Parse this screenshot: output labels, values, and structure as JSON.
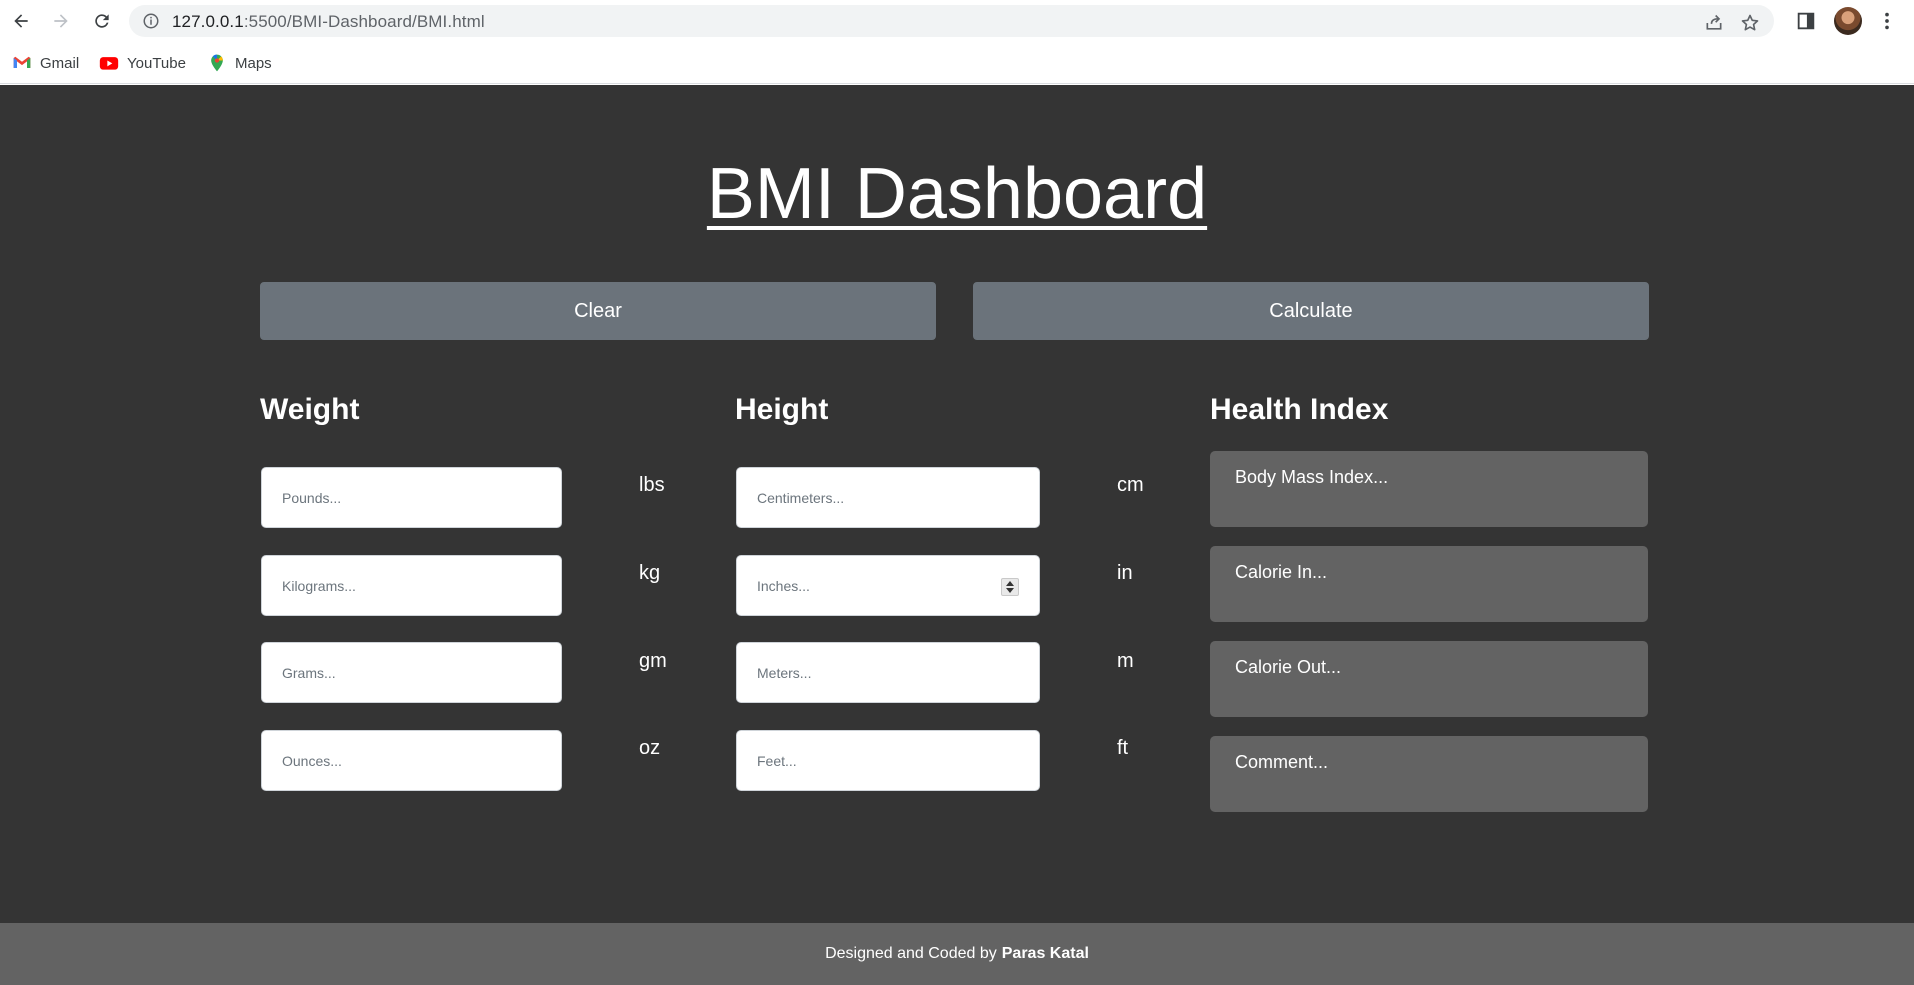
{
  "browser": {
    "url_host": "127.0.0.1",
    "url_path": ":5500/BMI-Dashboard/BMI.html",
    "bookmarks": [
      {
        "label": "Gmail",
        "icon": "gmail-icon"
      },
      {
        "label": "YouTube",
        "icon": "youtube-icon"
      },
      {
        "label": "Maps",
        "icon": "maps-icon"
      }
    ]
  },
  "page": {
    "title": "BMI Dashboard",
    "clear_label": "Clear",
    "calculate_label": "Calculate"
  },
  "weight": {
    "heading": "Weight",
    "fields": [
      {
        "placeholder": "Pounds...",
        "unit": "lbs"
      },
      {
        "placeholder": "Kilograms...",
        "unit": "kg"
      },
      {
        "placeholder": "Grams...",
        "unit": "gm"
      },
      {
        "placeholder": "Ounces...",
        "unit": "oz"
      }
    ]
  },
  "height": {
    "heading": "Height",
    "fields": [
      {
        "placeholder": "Centimeters...",
        "unit": "cm"
      },
      {
        "placeholder": "Inches...",
        "unit": "in"
      },
      {
        "placeholder": "Meters...",
        "unit": "m"
      },
      {
        "placeholder": "Feet...",
        "unit": "ft"
      }
    ]
  },
  "health": {
    "heading": "Health Index",
    "boxes": [
      "Body Mass Index...",
      "Calorie In...",
      "Calorie Out...",
      "Comment..."
    ]
  },
  "footer": {
    "text": "Designed and Coded by",
    "author": "Paras Katal"
  },
  "colors": {
    "page_bg": "#343434",
    "button_bg": "#6b737b",
    "box_bg": "#636363"
  }
}
